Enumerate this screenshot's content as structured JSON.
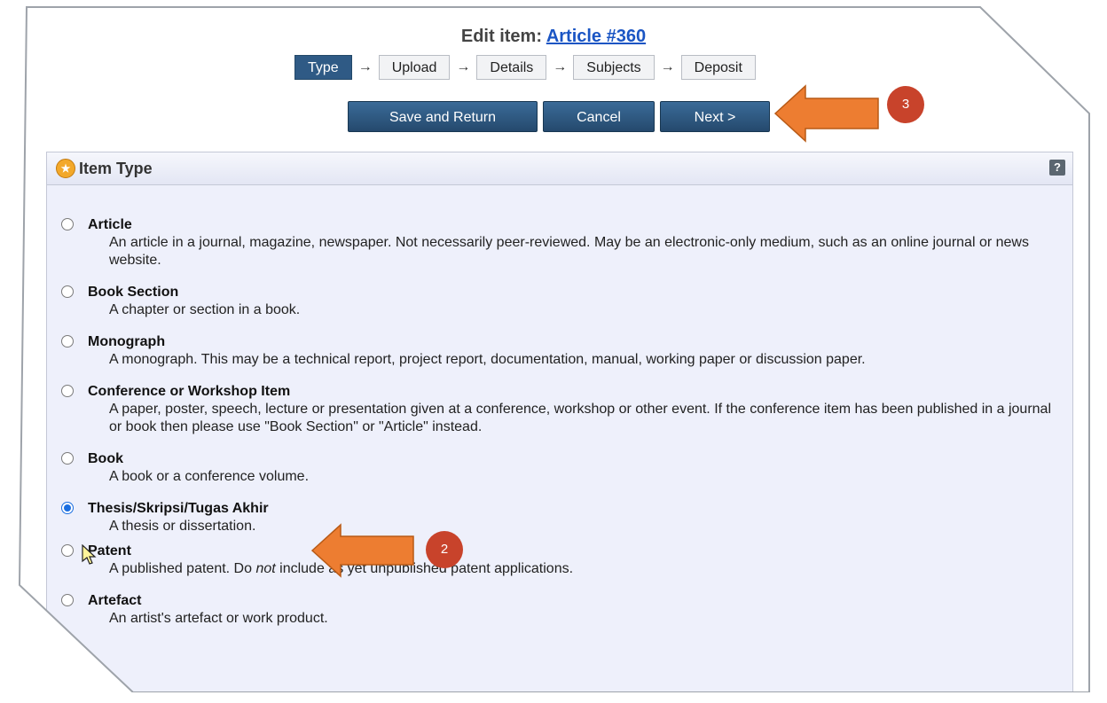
{
  "header": {
    "title_prefix": "Edit item: ",
    "title_link": "Article #360"
  },
  "steps": [
    {
      "label": "Type",
      "active": true
    },
    {
      "label": "Upload",
      "active": false
    },
    {
      "label": "Details",
      "active": false
    },
    {
      "label": "Subjects",
      "active": false
    },
    {
      "label": "Deposit",
      "active": false
    }
  ],
  "step_arrow": "→",
  "buttons": {
    "save_return": "Save and Return",
    "cancel": "Cancel",
    "next": "Next >"
  },
  "panel": {
    "title": "Item Type",
    "help": "?"
  },
  "item_types": [
    {
      "title": "Article",
      "desc": "An article in a journal, magazine, newspaper. Not necessarily peer-reviewed. May be an electronic-only medium, such as an online journal or news website.",
      "checked": false
    },
    {
      "title": "Book Section",
      "desc": "A chapter or section in a book.",
      "checked": false
    },
    {
      "title": "Monograph",
      "desc": "A monograph. This may be a technical report, project report, documentation, manual, working paper or discussion paper.",
      "checked": false
    },
    {
      "title": "Conference or Workshop Item",
      "desc": "A paper, poster, speech, lecture or presentation given at a conference, workshop or other event. If the conference item has been published in a journal or book then please use \"Book Section\" or \"Article\" instead.",
      "checked": false
    },
    {
      "title": "Book",
      "desc": "A book or a conference volume.",
      "checked": false
    },
    {
      "title": "Thesis/Skripsi/Tugas Akhir",
      "desc": "A thesis or dissertation.",
      "checked": true
    },
    {
      "title": "Patent",
      "desc_before": "A published patent. Do ",
      "desc_em": "not",
      "desc_after": " include as yet unpublished patent applications.",
      "checked": false
    },
    {
      "title": "Artefact",
      "desc": "An artist's artefact or work product.",
      "checked": false
    }
  ],
  "callouts": {
    "badge_top": "3",
    "badge_mid": "2",
    "color": "#ed7d31"
  }
}
